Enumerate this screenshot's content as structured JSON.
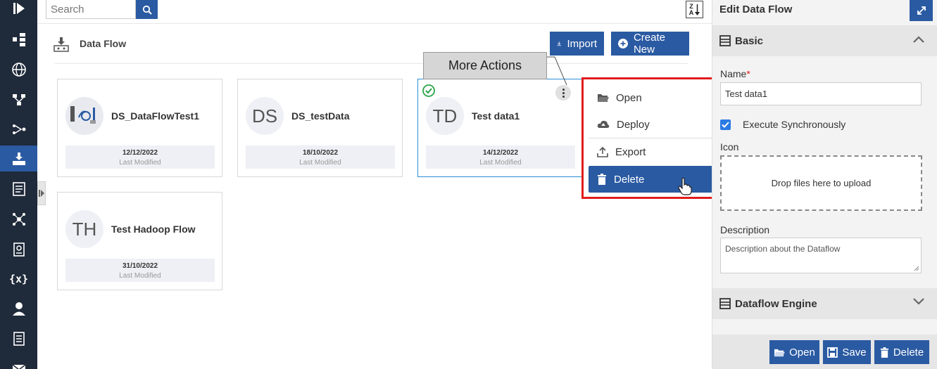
{
  "search": {
    "placeholder": "Search"
  },
  "sort": {
    "top": "Z",
    "bottom": "A"
  },
  "rail": {
    "vars_label": "{x}"
  },
  "header": {
    "title": "Data Flow",
    "import_label": "Import",
    "create_label": "Create New"
  },
  "cards": [
    {
      "name": "DS_DataFlowTest1",
      "avatar": "",
      "date": "12/12/2022",
      "label": "Last Modified"
    },
    {
      "name": "DS_testData",
      "avatar": "DS",
      "date": "18/10/2022",
      "label": "Last Modified"
    },
    {
      "name": "Test data1",
      "avatar": "TD",
      "date": "14/12/2022",
      "label": "Last Modified"
    },
    {
      "name": "Test Hadoop Flow",
      "avatar": "TH",
      "date": "31/10/2022",
      "label": "Last Modified"
    }
  ],
  "callout": {
    "text": "More Actions"
  },
  "menu": {
    "open": "Open",
    "deploy": "Deploy",
    "export": "Export",
    "delete": "Delete"
  },
  "panel": {
    "title": "Edit Data Flow",
    "basic": "Basic",
    "name_label": "Name",
    "required_mark": "*",
    "name_value": "Test data1",
    "exec_sync": "Execute Synchronously",
    "icon_label": "Icon",
    "drop_text": "Drop files here to upload",
    "desc_label": "Description",
    "desc_placeholder": "Description about the Dataflow",
    "engine": "Dataflow Engine",
    "open": "Open",
    "save": "Save",
    "delete": "Delete"
  },
  "colors": {
    "primary": "#2a5aa2",
    "rail": "#1f2a3a",
    "highlight": "#e11d1d"
  }
}
